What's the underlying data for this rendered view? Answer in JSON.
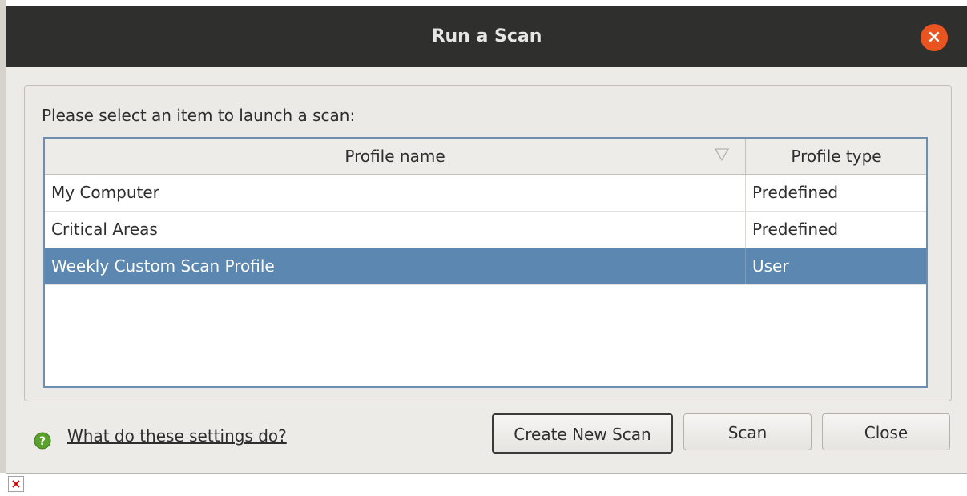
{
  "window": {
    "title": "Run a Scan",
    "close_glyph": "×"
  },
  "prompt": "Please select an item to launch a scan:",
  "table": {
    "headers": [
      "Profile name",
      "Profile type"
    ],
    "rows": [
      {
        "name": "My Computer",
        "type": "Predefined",
        "selected": false
      },
      {
        "name": "Critical Areas",
        "type": "Predefined",
        "selected": false
      },
      {
        "name": "Weekly Custom Scan Profile",
        "type": "User",
        "selected": true
      }
    ]
  },
  "footer": {
    "help_link": "What do these settings do?",
    "help_icon": "help-question-icon",
    "buttons": {
      "create": "Create New Scan",
      "scan": "Scan",
      "close": "Close"
    }
  },
  "broken_image_glyph": "×",
  "colors": {
    "titlebar": "#2f2f2d",
    "close_button": "#e95420",
    "selection": "#5c87b0",
    "help_icon": "#5aa02c"
  }
}
